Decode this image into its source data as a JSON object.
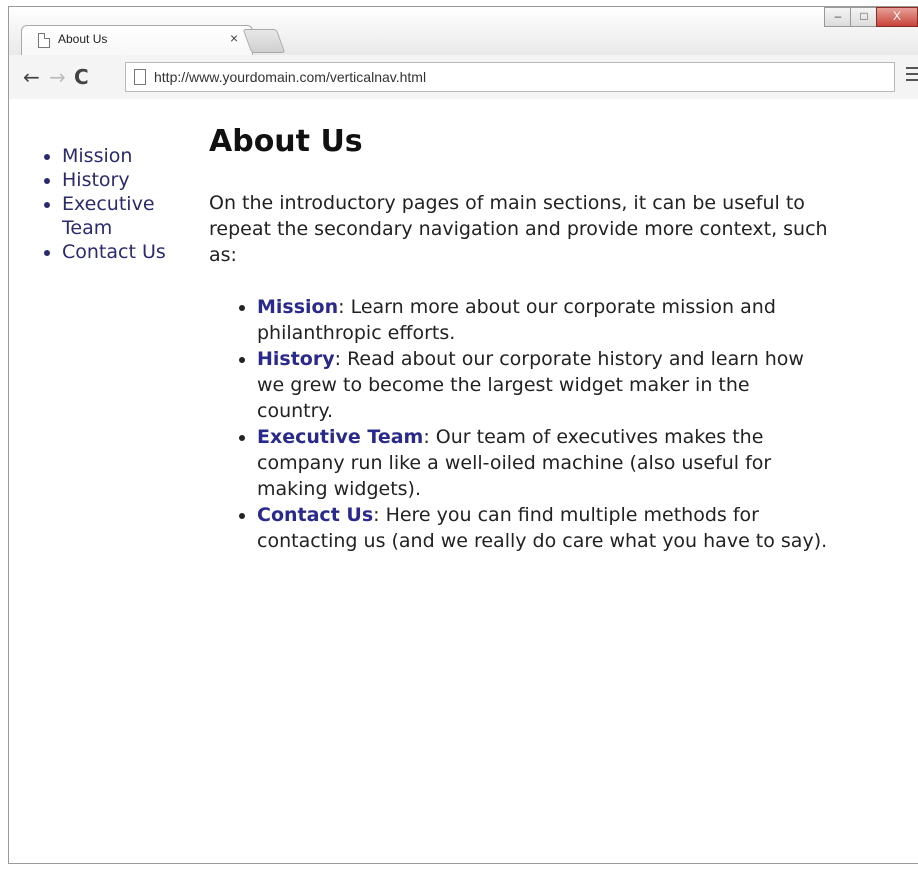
{
  "browser": {
    "tab_title": "About Us",
    "tab_close": "×",
    "window_controls": {
      "minimize": "–",
      "maximize": "□",
      "close": "X"
    },
    "address": "http://www.yourdomain.com/verticalnav.html",
    "icons": [
      "page-icon",
      "back-arrow-icon",
      "forward-arrow-icon",
      "reload-icon",
      "menu-icon"
    ]
  },
  "sidebar": {
    "items": [
      {
        "label": "Mission"
      },
      {
        "label": "History"
      },
      {
        "label": "Executive Team"
      },
      {
        "label": "Contact Us"
      }
    ]
  },
  "main": {
    "title": "About Us",
    "intro": "On the introductory pages of main sections, it can be useful to repeat the secondary navigation and provide more context, such as:",
    "items": [
      {
        "term": "Mission",
        "text": ": Learn more about our corporate mission and philanthropic efforts."
      },
      {
        "term": "History",
        "text": ": Read about our corporate history and learn how we grew to become the largest widget maker in the country."
      },
      {
        "term": "Executive Team",
        "text": ": Our team of executives makes the company run like a well-oiled machine (also useful for making widgets)."
      },
      {
        "term": "Contact Us",
        "text": ": Here you can find multiple methods for contacting us (and we really do care what you have to say)."
      }
    ]
  },
  "colors": {
    "link": "#2a2a6e",
    "term": "#2a2a8c",
    "close_button": "#c7443a"
  }
}
